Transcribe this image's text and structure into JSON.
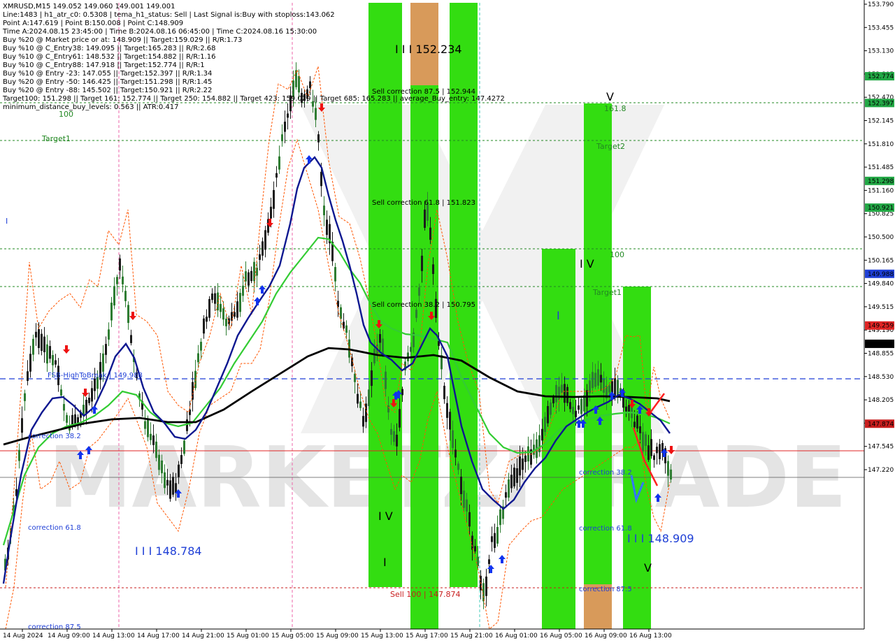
{
  "info": {
    "title": "XMRUSD,M15  149.052 149.060 149.001 149.001",
    "lines": [
      "Line:1483  |  h1_atr_c0: 0.5308  |  tema_h1_status: Sell  |  Last Signal is:Buy with stoploss:143.062",
      "Point A:147.619  |  Point B:150.008  |  Point C:148.909",
      "Time A:2024.08.15 23:45:00  |  Time B:2024.08.16 06:45:00  |  Time C:2024.08.16 15:30:00",
      "Buy %20 @ Market price or at: 148.909  ||  Target:159.029  ||  R/R:1.73",
      "Buy %10 @ C_Entry38: 149.095  ||  Target:165.283  ||  R/R:2.68",
      "Buy %10 @ C_Entry61: 148.532  ||  Target:154.882  ||  R/R:1.16",
      "Buy %10 @ C_Entry88: 147.918  ||  Target:152.774  ||  R/R:1",
      "Buy %10 @ Entry -23: 147.055  ||  Target:152.397  ||  R/R:1.34",
      "Buy %20 @ Entry -50: 146.425  ||  Target:151.298  ||  R/R:1.45",
      "Buy %20 @ Entry -88: 145.502  ||  Target:150.921  ||  R/R:2.22",
      "Target100: 151.298  ||  Target 161: 152.774  ||  Target 250: 154.882  ||  Target 423: 159.029  ||  Target 685: 165.283  ||  average_Buy_entry: 147.4272",
      "minimum_distance_buy_levels: 0.563  ||  ATR:0.417"
    ]
  },
  "watermark": "MARKETZITRADE",
  "price_axis": {
    "ticks": [
      "153.790",
      "153.455",
      "153.130",
      "152.805",
      "152.470",
      "152.145",
      "151.810",
      "151.485",
      "151.160",
      "150.825",
      "150.500",
      "150.165",
      "149.840",
      "149.515",
      "149.190",
      "148.855",
      "148.530",
      "148.205",
      "147.870",
      "147.545",
      "147.220"
    ],
    "boxes": [
      {
        "id": "p152774",
        "text": "152.774",
        "price": 152.774,
        "bg": "#22a845"
      },
      {
        "id": "p152397",
        "text": "152.397",
        "price": 152.397,
        "bg": "#22a845"
      },
      {
        "id": "p151298",
        "text": "151.298",
        "price": 151.298,
        "bg": "#22a845"
      },
      {
        "id": "p150921",
        "text": "150.921",
        "price": 150.921,
        "bg": "#22a845"
      },
      {
        "id": "p149988",
        "text": "149.988",
        "price": 149.988,
        "bg": "#1f3fd6"
      },
      {
        "id": "p149259",
        "text": "149.259",
        "price": 149.259,
        "bg": "#e02424"
      },
      {
        "id": "p149001",
        "text": "149.001",
        "price": 149.001,
        "bg": "#000000"
      },
      {
        "id": "p147874",
        "text": "147.874",
        "price": 147.874,
        "bg": "#c81e1e"
      }
    ]
  },
  "time_axis": {
    "ticks": [
      "14 Aug 2024",
      "14 Aug 09:00",
      "14 Aug 13:00",
      "14 Aug 17:00",
      "14 Aug 21:00",
      "15 Aug 01:00",
      "15 Aug 05:00",
      "15 Aug 09:00",
      "15 Aug 13:00",
      "15 Aug 17:00",
      "15 Aug 21:00",
      "16 Aug 01:00",
      "16 Aug 05:00",
      "16 Aug 09:00",
      "16 Aug 13:00"
    ]
  },
  "labels": {
    "l100_top": "100",
    "target1_left": "Target1",
    "wave_i_left": "I",
    "fsb": "FSB-HighToBreak | 149.988",
    "corr38_left": "correction 38.2",
    "corr61_left": "correction 61.8",
    "corr87_left": "correction 87.5",
    "lvl_148784": "I I I 148.784",
    "lvl_152234": "I I I 152.234",
    "sell_corr_875": "Sell correction 87.5 | 152.944",
    "sell_corr_618": "Sell correction 61.8 | 151.823",
    "sell_corr_382": "Sell correction 38.2 | 150.795",
    "sell_100": "Sell 100 | 147.874",
    "wave_iv_mid": "I V",
    "wave_i_mid": "I",
    "wave_v_top": "V",
    "l161": "161.8",
    "target2": "Target2",
    "l100_right": "100",
    "target1_right": "Target1",
    "wave_iv_right": "I V",
    "wave_i_right": "I",
    "corr38_right": "correction 38.2",
    "corr61_right": "correction 61.8",
    "corr87_right": "correction 87.5",
    "lvl_148909": "I I I 148.909",
    "wave_v_right": "V"
  },
  "colors": {
    "green_zone": "#33dd11",
    "orange_zone": "#d89a5a",
    "ma_black": "#000000",
    "ma_navy": "#0d1790",
    "ma_green": "#33cc33",
    "band_orange": "#ff5500",
    "buy_arrow": "#1133ee",
    "sell_arrow": "#ee1111"
  }
}
